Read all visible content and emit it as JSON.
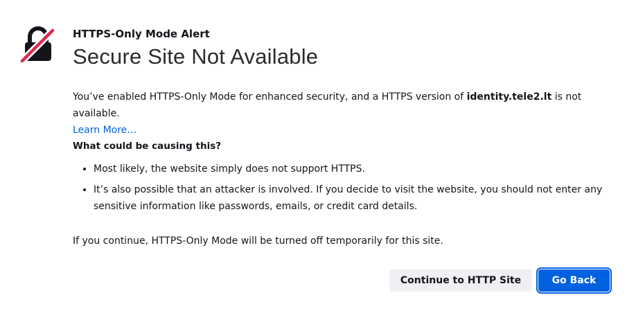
{
  "alert": {
    "title": "HTTPS-Only Mode Alert",
    "headline": "Secure Site Not Available",
    "icon": "broken-lock-icon",
    "icon_color": "#15141a",
    "icon_slash_color": "#e22850"
  },
  "intro": {
    "text_before": "You’ve enabled HTTPS-Only Mode for enhanced security, and a HTTPS version of ",
    "domain": "identity.tele2.lt",
    "text_after": " is not available.",
    "learn_more": "Learn More…"
  },
  "causes": {
    "heading": "What could be causing this?",
    "items": [
      "Most likely, the website simply does not support HTTPS.",
      "It’s also possible that an attacker is involved. If you decide to visit the website, you should not enter any sensitive information like passwords, emails, or credit card details."
    ]
  },
  "continue_note": "If you continue, HTTPS-Only Mode will be turned off temporarily for this site.",
  "buttons": {
    "continue_label": "Continue to HTTP Site",
    "go_back_label": "Go Back"
  },
  "colors": {
    "accent": "#0061e0",
    "secondary_button_bg": "#f0f0f4",
    "text": "#15141a"
  }
}
